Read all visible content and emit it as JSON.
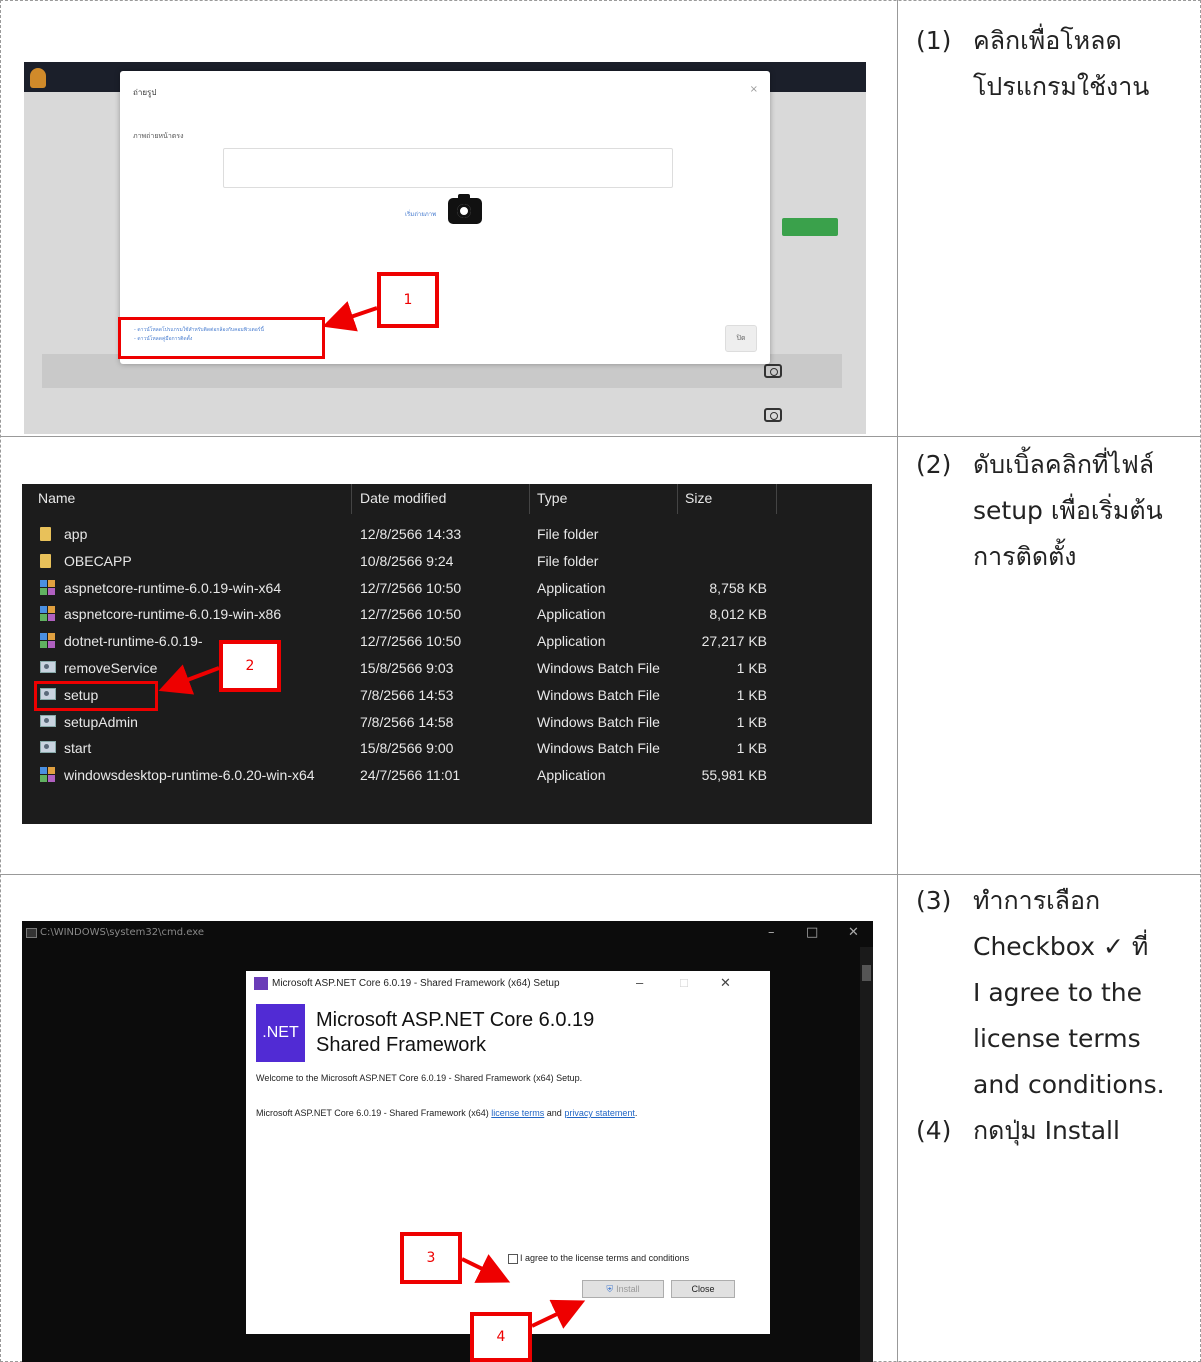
{
  "steps": [
    {
      "num": "(1)",
      "text": "คลิกเพื่อโหลด\nโปรแกรมใช้งาน"
    },
    {
      "num": "(2)",
      "text": "ดับเบิ้ลคลิกที่ไฟล์\nsetup เพื่อเริ่มต้น\nการติดตั้ง"
    },
    {
      "num": "(3)",
      "text": "ทำการเลือก\nCheckbox ✓ ที่\nI agree to the\nlicense terms\nand conditions."
    },
    {
      "num": "(4)",
      "text": "กดปุ่ม Install"
    }
  ],
  "callouts": [
    "1",
    "2",
    "3",
    "4"
  ],
  "web_modal": {
    "title": "ถ่ายรูป",
    "close": "×",
    "field_label": "ภาพถ่ายหน้าตรง",
    "link": "เริ่มถ่ายภาพ",
    "footer_links": [
      "- ดาวน์โหลดโปรแกรมใช้สำหรับติดต่อกล้องกับคอมพิวเตอร์นี้",
      "- ดาวน์โหลดคู่มือการติดตั้ง"
    ],
    "button": "ปิด"
  },
  "explorer": {
    "headers": {
      "name": "Name",
      "date": "Date modified",
      "type": "Type",
      "size": "Size"
    },
    "files": [
      {
        "name": "app",
        "date": "12/8/2566 14:33",
        "type": "File folder",
        "size": "",
        "icon": "folder"
      },
      {
        "name": "OBECAPP",
        "date": "10/8/2566 9:24",
        "type": "File folder",
        "size": "",
        "icon": "folder"
      },
      {
        "name": "aspnetcore-runtime-6.0.19-win-x64",
        "date": "12/7/2566 10:50",
        "type": "Application",
        "size": "8,758 KB",
        "icon": "app"
      },
      {
        "name": "aspnetcore-runtime-6.0.19-win-x86",
        "date": "12/7/2566 10:50",
        "type": "Application",
        "size": "8,012 KB",
        "icon": "app"
      },
      {
        "name": "dotnet-runtime-6.0.19-",
        "date": "12/7/2566 10:50",
        "type": "Application",
        "size": "27,217 KB",
        "icon": "app"
      },
      {
        "name": "removeService",
        "date": "15/8/2566 9:03",
        "type": "Windows Batch File",
        "size": "1 KB",
        "icon": "batch"
      },
      {
        "name": "setup",
        "date": "7/8/2566 14:53",
        "type": "Windows Batch File",
        "size": "1 KB",
        "icon": "batch"
      },
      {
        "name": "setupAdmin",
        "date": "7/8/2566 14:58",
        "type": "Windows Batch File",
        "size": "1 KB",
        "icon": "batch"
      },
      {
        "name": "start",
        "date": "15/8/2566 9:00",
        "type": "Windows Batch File",
        "size": "1 KB",
        "icon": "batch"
      },
      {
        "name": "windowsdesktop-runtime-6.0.20-win-x64",
        "date": "24/7/2566 11:01",
        "type": "Application",
        "size": "55,981 KB",
        "icon": "app"
      }
    ]
  },
  "cmd": {
    "title": "C:\\WINDOWS\\system32\\cmd.exe"
  },
  "installer": {
    "window_title": "Microsoft ASP.NET Core 6.0.19 - Shared Framework (x64) Setup",
    "badge": ".NET",
    "heading_line1": "Microsoft ASP.NET Core 6.0.19",
    "heading_line2": "Shared Framework",
    "welcome": "Welcome to the Microsoft ASP.NET Core 6.0.19 - Shared Framework (x64) Setup.",
    "terms_prefix": "Microsoft ASP.NET Core 6.0.19 - Shared Framework (x64) ",
    "license_link": "license terms",
    "and": " and ",
    "privacy_link": "privacy statement",
    "period": ".",
    "agree_label": "I agree to the license terms and conditions",
    "install_button": "Install",
    "close_button": "Close"
  }
}
